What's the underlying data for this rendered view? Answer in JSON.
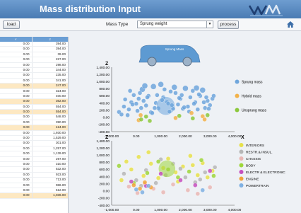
{
  "window": {
    "title": "Mass distribution Input"
  },
  "toolbar": {
    "load_label": "load",
    "mass_type_label": "Mass Type",
    "mass_type_value": "Sprung weight",
    "process_label": "process"
  },
  "car": {
    "label": "Sprung Mass"
  },
  "grid": {
    "columns": [
      "Y",
      "Z"
    ],
    "rows": [
      [
        "0.00",
        "394.00"
      ],
      [
        "0.00",
        "394.00"
      ],
      [
        "0.00",
        "39.00"
      ],
      [
        "0.00",
        "227.00"
      ],
      [
        "0.00",
        "298.00"
      ],
      [
        "0.00",
        "344.00"
      ],
      [
        "0.00",
        "235.00"
      ],
      [
        "0.00",
        "341.00"
      ],
      [
        "0.00",
        "247.00"
      ],
      [
        "0.00",
        "324.00"
      ],
      [
        "0.00",
        "400.00"
      ],
      [
        "0.00",
        "362.00"
      ],
      [
        "0.00",
        "554.00"
      ],
      [
        "0.00",
        "554.00"
      ],
      [
        "0.00",
        "548.00"
      ],
      [
        "0.00",
        "390.00"
      ],
      [
        "0.00",
        "424.00"
      ],
      [
        "0.00",
        "1,930.00"
      ],
      [
        "0.00",
        "1,529.00"
      ],
      [
        "0.00",
        "301.00"
      ],
      [
        "0.00",
        "1,257.00"
      ],
      [
        "0.00",
        "1,139.00"
      ],
      [
        "0.00",
        "297.00"
      ],
      [
        "0.00",
        "310.00"
      ],
      [
        "0.00",
        "532.00"
      ],
      [
        "0.00",
        "923.00"
      ],
      [
        "0.00",
        "713.00"
      ],
      [
        "0.00",
        "986.00"
      ],
      [
        "0.00",
        "612.00"
      ],
      [
        "0.00",
        "1,036.00"
      ]
    ],
    "highlight_rows": [
      8,
      11,
      13,
      16,
      29
    ]
  },
  "chart_top": {
    "y_axis_title": "Z",
    "y_ticks": [
      "1,400.00",
      "1,200.00",
      "1,000.00",
      "800.00",
      "600.00",
      "400.00",
      "200.00",
      "0.00",
      "-200.00",
      "-400.00"
    ],
    "x_ticks": [
      "-1,000.00",
      "0.00",
      "1,000.00",
      "2,000.00",
      "3,000.00",
      "4,000.00"
    ],
    "x_axis_title": "X"
  },
  "chart_bottom": {
    "y_axis_title": "Z",
    "y_ticks": [
      "1,400.00",
      "1,200.00",
      "1,000.00",
      "800.00",
      "600.00",
      "400.00",
      "200.00",
      "0.00",
      "-200.00",
      "-400.00"
    ],
    "x_ticks": [
      "-1,000.00",
      "0.00",
      "1,000.00",
      "2,000.00",
      "3,000.00",
      "4,000.00"
    ]
  },
  "colors": {
    "title_bar": "#4a7bb3",
    "car": "#5d9ad2",
    "sprung": "#6fa6dc",
    "hybrid": "#f2b24a",
    "unsprung": "#8cc83c",
    "grid_header": "#6a9ed4",
    "row_highlight": "#fde8c2"
  },
  "chart_data": [
    {
      "type": "scatter",
      "xlim": [
        -1000,
        4000
      ],
      "ylim": [
        -400,
        1400
      ],
      "series": [
        {
          "name": "Sprung mass",
          "color": "#6fa6dc",
          "x": [
            -700,
            -500,
            -450,
            -300,
            -200,
            -100,
            0,
            50,
            100,
            200,
            250,
            300,
            400,
            500,
            600,
            700,
            800,
            900,
            1000,
            1100,
            1200,
            1250,
            1300,
            1400,
            1500,
            1600,
            1700,
            1800,
            1900,
            2000,
            2100,
            2200,
            2300,
            2400,
            2500,
            2600,
            2700,
            2800,
            2900,
            3000,
            -600,
            -350,
            -150,
            150,
            450,
            650,
            850,
            1050,
            1350,
            1550,
            1750,
            1950,
            2150,
            2350,
            2550,
            2750,
            2950,
            3100,
            3150,
            -250,
            350,
            750,
            1150,
            1450,
            1850,
            2450,
            2850
          ],
          "y": [
            150,
            300,
            500,
            220,
            420,
            620,
            380,
            180,
            520,
            260,
            780,
            460,
            330,
            600,
            140,
            860,
            400,
            250,
            920,
            560,
            320,
            430,
            380,
            720,
            240,
            680,
            360,
            520,
            240,
            810,
            300,
            560,
            740,
            420,
            220,
            600,
            760,
            260,
            460,
            340,
            80,
            60,
            360,
            680,
            560,
            120,
            620,
            480,
            160,
            840,
            540,
            280,
            160,
            380,
            640,
            420,
            240,
            520,
            600,
            740,
            880,
            260,
            780,
            340,
            620,
            820,
            560
          ],
          "sizes": [
            3,
            3,
            3,
            3,
            3,
            3,
            3,
            3,
            3,
            3,
            4,
            3,
            3,
            3,
            3,
            4,
            3,
            3,
            4,
            3,
            13,
            3,
            3,
            3,
            3,
            3,
            3,
            3,
            3,
            4,
            3,
            3,
            3,
            3,
            3,
            3,
            4,
            3,
            3,
            3,
            3,
            3,
            3,
            3,
            3,
            3,
            3,
            3,
            3,
            4,
            3,
            3,
            3,
            3,
            3,
            3,
            3,
            3,
            3,
            3,
            4,
            3,
            3,
            3,
            3,
            4,
            3
          ]
        },
        {
          "name": "Hybrid mass",
          "color": "#f2b24a",
          "x": [
            100,
            180,
            1600,
            2250,
            2700,
            2780
          ],
          "y": [
            -80,
            60,
            -20,
            120,
            30,
            -60
          ],
          "sizes": [
            3,
            3,
            3,
            3,
            3,
            3
          ]
        },
        {
          "name": "Unsprung mass",
          "color": "#8cc83c",
          "x": [
            200,
            400,
            550,
            1750,
            2300,
            2900
          ],
          "y": [
            -60,
            20,
            -100,
            40,
            -30,
            60
          ],
          "sizes": [
            3,
            3,
            3,
            3,
            3,
            3
          ]
        }
      ]
    },
    {
      "type": "scatter",
      "xlim": [
        -1000,
        4000
      ],
      "ylim": [
        -400,
        1400
      ],
      "series": [
        {
          "name": "INTERIORS",
          "color": "#e6e04a",
          "x": [
            -400,
            -200,
            100,
            300,
            600,
            900,
            1300,
            1600,
            1900,
            2200,
            2500,
            2700,
            3100,
            -600,
            500,
            1100,
            1700,
            2300,
            2900
          ],
          "y": [
            820,
            600,
            950,
            420,
            760,
            360,
            900,
            520,
            680,
            980,
            440,
            780,
            560,
            300,
            1080,
            640,
            260,
            720,
            380
          ],
          "sizes": [
            3,
            3,
            3,
            3,
            3,
            3,
            3,
            3,
            3,
            3,
            3,
            3,
            3,
            3,
            3,
            3,
            3,
            3,
            3
          ]
        },
        {
          "name": "RESTR.& INSUL.",
          "color": "#b6b6b6",
          "x": [
            -500,
            0,
            400,
            800,
            1200,
            1500,
            2000,
            2400,
            2800,
            3200,
            200,
            1000,
            1800,
            2600
          ],
          "y": [
            480,
            300,
            580,
            220,
            440,
            760,
            380,
            240,
            520,
            660,
            140,
            880,
            620,
            320
          ],
          "sizes": [
            3,
            3,
            3,
            3,
            3,
            3,
            3,
            3,
            3,
            3,
            3,
            3,
            3,
            3
          ]
        },
        {
          "name": "CHASSIS",
          "color": "#e9b7b4",
          "x": [
            -300,
            50,
            350,
            700,
            1100,
            1500,
            2100,
            2500,
            3000
          ],
          "y": [
            120,
            -60,
            200,
            60,
            -40,
            180,
            20,
            -80,
            100
          ],
          "sizes": [
            3,
            3,
            3,
            3,
            3,
            3,
            3,
            3,
            3
          ]
        },
        {
          "name": "BODY",
          "color": "#9ed63a",
          "x": [
            -700,
            -100,
            450,
            900,
            1300,
            1700,
            2150,
            2650,
            3150,
            1250
          ],
          "y": [
            700,
            220,
            500,
            820,
            600,
            380,
            540,
            860,
            420,
            620
          ],
          "sizes": [
            3,
            3,
            3,
            3,
            3,
            3,
            3,
            3,
            3,
            12
          ]
        },
        {
          "name": "ELECTR & ELECTRONIC",
          "color": "#c64fbe",
          "x": [
            -200,
            400,
            1000,
            1800,
            2400,
            3000
          ],
          "y": [
            260,
            140,
            480,
            300,
            160,
            560
          ],
          "sizes": [
            3,
            3,
            3,
            3,
            3,
            3
          ]
        },
        {
          "name": "ENGINE",
          "color": "#f2a33a",
          "x": [
            -100,
            150,
            350,
            600
          ],
          "y": [
            160,
            60,
            240,
            100
          ],
          "sizes": [
            3,
            3,
            3,
            3
          ]
        },
        {
          "name": "POWERTRAIN",
          "color": "#7fb0e2",
          "x": [
            0,
            250,
            500,
            2700
          ],
          "y": [
            40,
            -40,
            140,
            20
          ],
          "sizes": [
            3,
            3,
            3,
            3
          ]
        }
      ]
    }
  ]
}
